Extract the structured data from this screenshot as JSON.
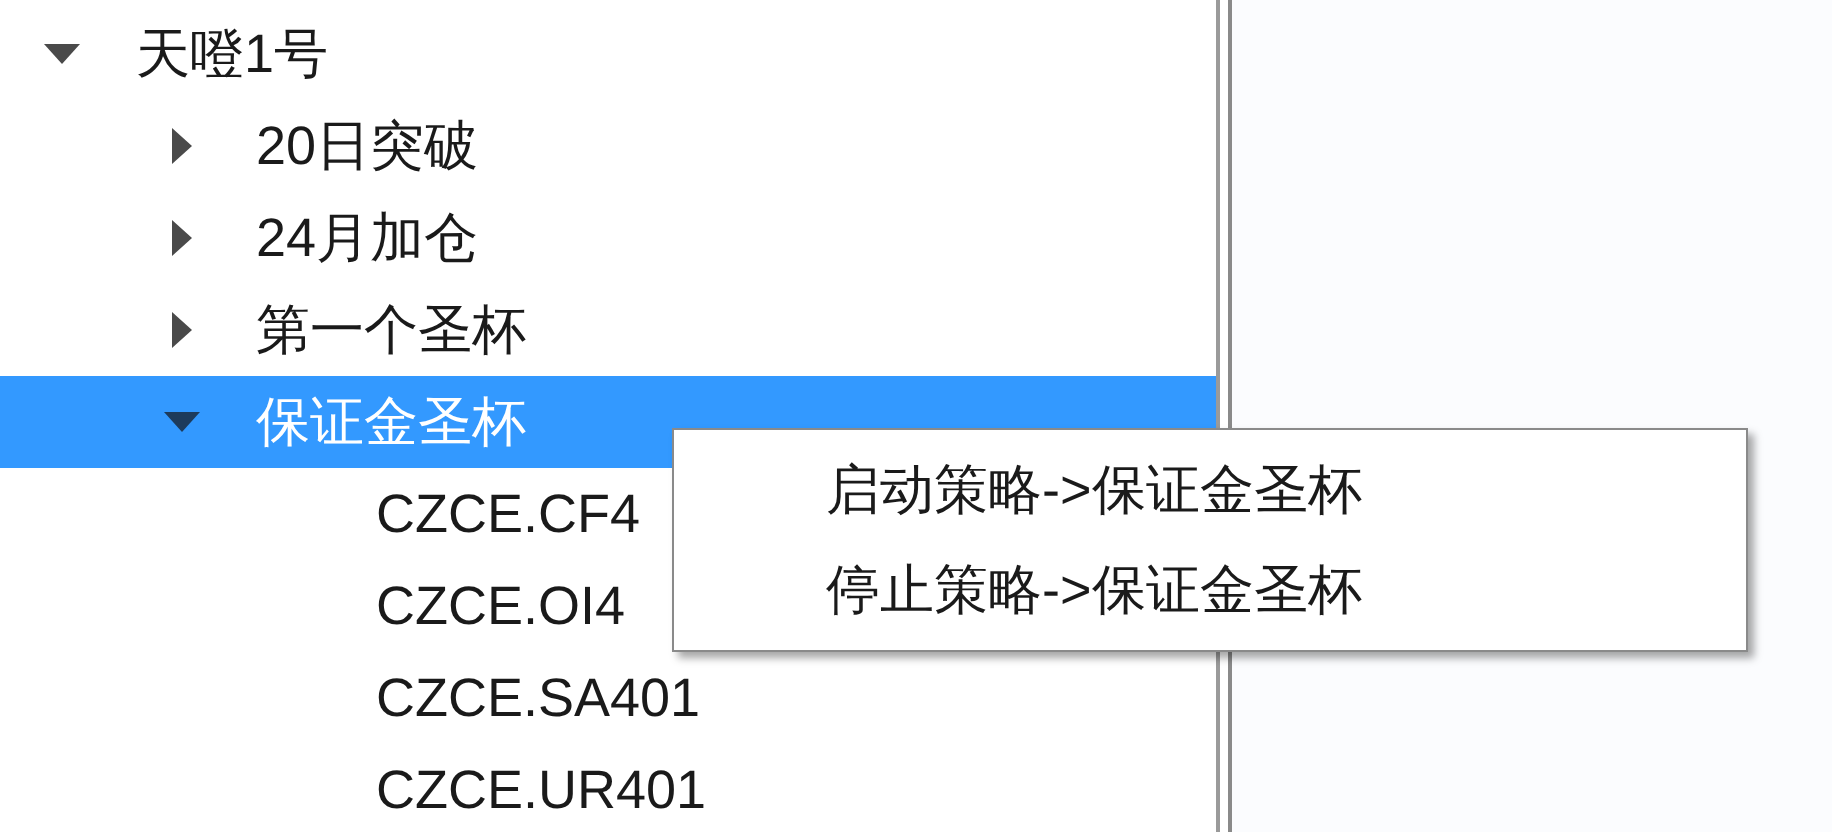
{
  "tree": [
    {
      "label": "天噔1号",
      "expanded": true,
      "selected": false,
      "children": [
        {
          "label": "20日突破",
          "expanded": false,
          "selected": false
        },
        {
          "label": "24月加仓",
          "expanded": false,
          "selected": false
        },
        {
          "label": "第一个圣杯",
          "expanded": false,
          "selected": false
        },
        {
          "label": "保证金圣杯",
          "expanded": true,
          "selected": true,
          "children": [
            {
              "label": "CZCE.CF4",
              "selected": false
            },
            {
              "label": "CZCE.OI4",
              "selected": false
            },
            {
              "label": "CZCE.SA401",
              "selected": false
            },
            {
              "label": "CZCE.UR401",
              "selected": false
            }
          ]
        }
      ]
    }
  ],
  "context_menu": {
    "items": [
      "启动策略->保证金圣杯",
      "停止策略->保证金圣杯"
    ]
  }
}
